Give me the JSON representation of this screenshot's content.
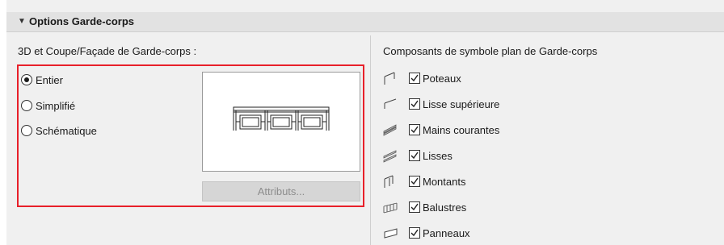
{
  "header": {
    "title": "Options Garde-corps"
  },
  "left": {
    "label": "3D et Coupe/Façade de Garde-corps :",
    "options": [
      {
        "label": "Entier",
        "checked": true
      },
      {
        "label": "Simplifié",
        "checked": false
      },
      {
        "label": "Schématique",
        "checked": false
      }
    ],
    "attributes_button": "Attributs..."
  },
  "right": {
    "label": "Composants de symbole plan de Garde-corps",
    "components": [
      {
        "label": "Poteaux",
        "checked": true,
        "icon": "post-icon"
      },
      {
        "label": "Lisse supérieure",
        "checked": true,
        "icon": "top-rail-icon"
      },
      {
        "label": "Mains courantes",
        "checked": true,
        "icon": "handrail-icon"
      },
      {
        "label": "Lisses",
        "checked": true,
        "icon": "rails-icon"
      },
      {
        "label": "Montants",
        "checked": true,
        "icon": "uprights-icon"
      },
      {
        "label": "Balustres",
        "checked": true,
        "icon": "balusters-icon"
      },
      {
        "label": "Panneaux",
        "checked": true,
        "icon": "panels-icon"
      }
    ]
  },
  "colors": {
    "highlight": "#e8202a",
    "header_bg": "#e2e2e2",
    "panel_bg": "#f0f0f0"
  }
}
